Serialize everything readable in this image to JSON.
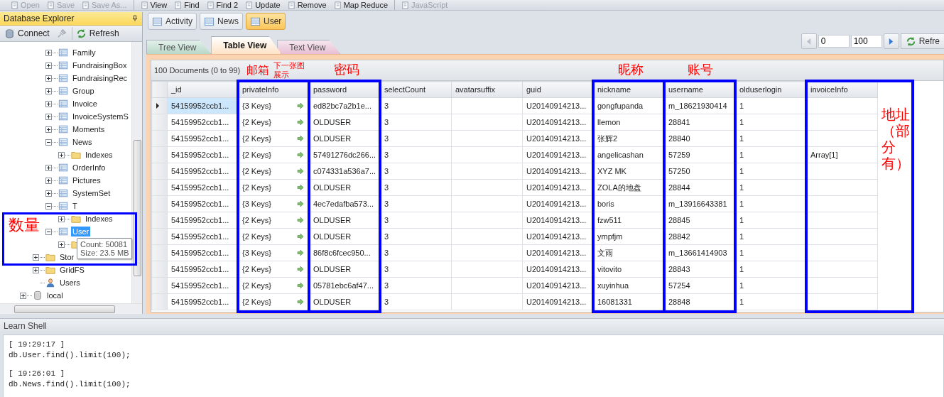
{
  "toolbar": [
    [
      {
        "label": "Open",
        "disabled": true
      },
      {
        "label": "Save",
        "disabled": true
      },
      {
        "label": "Save As...",
        "disabled": true
      }
    ],
    [
      {
        "label": "View",
        "disabled": false
      },
      {
        "label": "Find",
        "disabled": false
      },
      {
        "label": "Find 2",
        "disabled": false
      },
      {
        "label": "Update",
        "disabled": false
      },
      {
        "label": "Remove",
        "disabled": false
      },
      {
        "label": "Map Reduce",
        "disabled": false
      }
    ],
    [
      {
        "label": "JavaScript",
        "disabled": true
      }
    ]
  ],
  "explorer": {
    "title": "Database Explorer",
    "buttons": [
      {
        "label": "Connect",
        "disabled": false
      },
      {
        "label": "Refresh",
        "disabled": false
      }
    ],
    "tree": [
      {
        "children": [
          {
            "children": [
              {
                "label": "Family",
                "kind": "collection",
                "expanded": false,
                "selected": false
              },
              {
                "label": "FundraisingBox",
                "kind": "collection",
                "expanded": false,
                "selected": false
              },
              {
                "label": "FundraisingRec",
                "kind": "collection",
                "expanded": false,
                "selected": false
              },
              {
                "label": "Group",
                "kind": "collection",
                "expanded": false,
                "selected": false
              },
              {
                "label": "Invoice",
                "kind": "collection",
                "expanded": false,
                "selected": false
              },
              {
                "label": "InvoiceSystemS",
                "kind": "collection",
                "expanded": false,
                "selected": false
              },
              {
                "label": "Moments",
                "kind": "collection",
                "expanded": false,
                "selected": false
              },
              {
                "label": "News",
                "kind": "collection",
                "expanded": true,
                "selected": false,
                "children": [
                  {
                    "label": "Indexes",
                    "kind": "folder",
                    "expanded": false,
                    "selected": false
                  }
                ]
              },
              {
                "label": "OrderInfo",
                "kind": "collection",
                "expanded": false,
                "selected": false
              },
              {
                "label": "Pictures",
                "kind": "collection",
                "expanded": false,
                "selected": false
              },
              {
                "label": "SystemSet",
                "kind": "collection",
                "expanded": false,
                "selected": false
              },
              {
                "label": "T",
                "kind": "collection",
                "expanded": true,
                "selected": false,
                "children": [
                  {
                    "label": "Indexes",
                    "kind": "folder",
                    "expanded": false,
                    "selected": false
                  }
                ]
              },
              {
                "label": "User",
                "kind": "collection",
                "expanded": true,
                "selected": true,
                "children": [
                  {
                    "kind": "folder",
                    "expanded": false
                  }
                ]
              }
            ]
          },
          {
            "label": "Stor",
            "kind": "folder",
            "expanded": false,
            "selected": false
          },
          {
            "label": "GridFS",
            "kind": "folder",
            "expanded": false,
            "selected": false
          },
          {
            "label": "Users",
            "kind": "user",
            "selected": false
          }
        ]
      },
      {
        "label": "local",
        "kind": "database",
        "expanded": false,
        "selected": false
      }
    ],
    "tooltip": [
      "Count: 50081",
      "Size: 23.5 MB"
    ]
  },
  "doc_tabs": [
    {
      "label": "Activity",
      "selected": false
    },
    {
      "label": "News",
      "selected": false
    },
    {
      "label": "User",
      "selected": true
    }
  ],
  "view_tabs": [
    {
      "label": "Tree View",
      "selected": false
    },
    {
      "label": "Table View",
      "selected": true
    },
    {
      "label": "Text View",
      "selected": false
    }
  ],
  "pager": {
    "skip": "0",
    "limit": "100",
    "refresh": "Refre"
  },
  "documents_label": "100 Documents (0 to 99)",
  "table": {
    "columns": [
      "_id",
      "privateInfo",
      "password",
      "selectCount",
      "avatarsuffix",
      "guid",
      "nickname",
      "username",
      "olduserlogin",
      "invoiceInfo"
    ],
    "rows": [
      {
        "selected": true,
        "cells": [
          "54159952ccb1...",
          "{3 Keys}",
          "ed82bc7a2b1e...",
          "3",
          null,
          "U20140914213...",
          "gongfupanda",
          "m_18621930414",
          "1",
          null
        ]
      },
      {
        "selected": false,
        "cells": [
          "54159952ccb1...",
          "{2 Keys}",
          "OLDUSER",
          "3",
          null,
          "U20140914213...",
          "llemon",
          "28841",
          "1",
          null
        ]
      },
      {
        "selected": false,
        "cells": [
          "54159952ccb1...",
          "{2 Keys}",
          "OLDUSER",
          "3",
          null,
          "U20140914213...",
          "张辉2",
          "28840",
          "1",
          null
        ]
      },
      {
        "selected": false,
        "cells": [
          "54159952ccb1...",
          "{2 Keys}",
          "57491276dc266...",
          "3",
          null,
          "U20140914213...",
          "angelicashan",
          "57259",
          "1",
          "Array[1]"
        ]
      },
      {
        "selected": false,
        "cells": [
          "54159952ccb1...",
          "{2 Keys}",
          "c074331a536a7...",
          "3",
          null,
          "U20140914213...",
          "XYZ MK",
          "57250",
          "1",
          null
        ]
      },
      {
        "selected": false,
        "cells": [
          "54159952ccb1...",
          "{2 Keys}",
          "OLDUSER",
          "3",
          null,
          "U20140914213...",
          "ZOLA的地盘",
          "28844",
          "1",
          null
        ]
      },
      {
        "selected": false,
        "cells": [
          "54159952ccb1...",
          "{3 Keys}",
          "4ec7edafba573...",
          "3",
          null,
          "U20140914213...",
          "boris",
          "m_13916643381",
          "1",
          null
        ]
      },
      {
        "selected": false,
        "cells": [
          "54159952ccb1...",
          "{2 Keys}",
          "OLDUSER",
          "3",
          null,
          "U20140914213...",
          "fzw511",
          "28845",
          "1",
          null
        ]
      },
      {
        "selected": false,
        "cells": [
          "54159952ccb1...",
          "{2 Keys}",
          "OLDUSER",
          "3",
          null,
          "U20140914213...",
          "ympfjm",
          "28842",
          "1",
          null
        ]
      },
      {
        "selected": false,
        "cells": [
          "54159952ccb1...",
          "{3 Keys}",
          "86f8c6fcec950...",
          "3",
          null,
          "U20140914213...",
          "文雨",
          "m_13661414903",
          "1",
          null
        ]
      },
      {
        "selected": false,
        "cells": [
          "54159952ccb1...",
          "{2 Keys}",
          "OLDUSER",
          "3",
          null,
          "U20140914213...",
          "vitovito",
          "28843",
          "1",
          null
        ]
      },
      {
        "selected": false,
        "cells": [
          "54159952ccb1...",
          "{2 Keys}",
          "05781ebc6af47...",
          "3",
          null,
          "U20140914213...",
          "xuyinhua",
          "57254",
          "1",
          null
        ]
      },
      {
        "selected": false,
        "cells": [
          "54159952ccb1...",
          "{2 Keys}",
          "OLDUSER",
          "3",
          null,
          "U20140914213...",
          "16081331",
          "28848",
          "1",
          null
        ]
      }
    ]
  },
  "shell": {
    "title": "Learn Shell",
    "entries": [
      {
        "time": "[ 19:29:17 ]",
        "command": "db.User.find().limit(100);"
      },
      {
        "time": "[ 19:26:01 ]",
        "command": "db.News.find().limit(100);"
      }
    ]
  },
  "annotations": [
    "邮箱",
    "下一张图展示",
    "密码",
    "昵称",
    "账号",
    "地址（部分有）",
    "数量"
  ]
}
